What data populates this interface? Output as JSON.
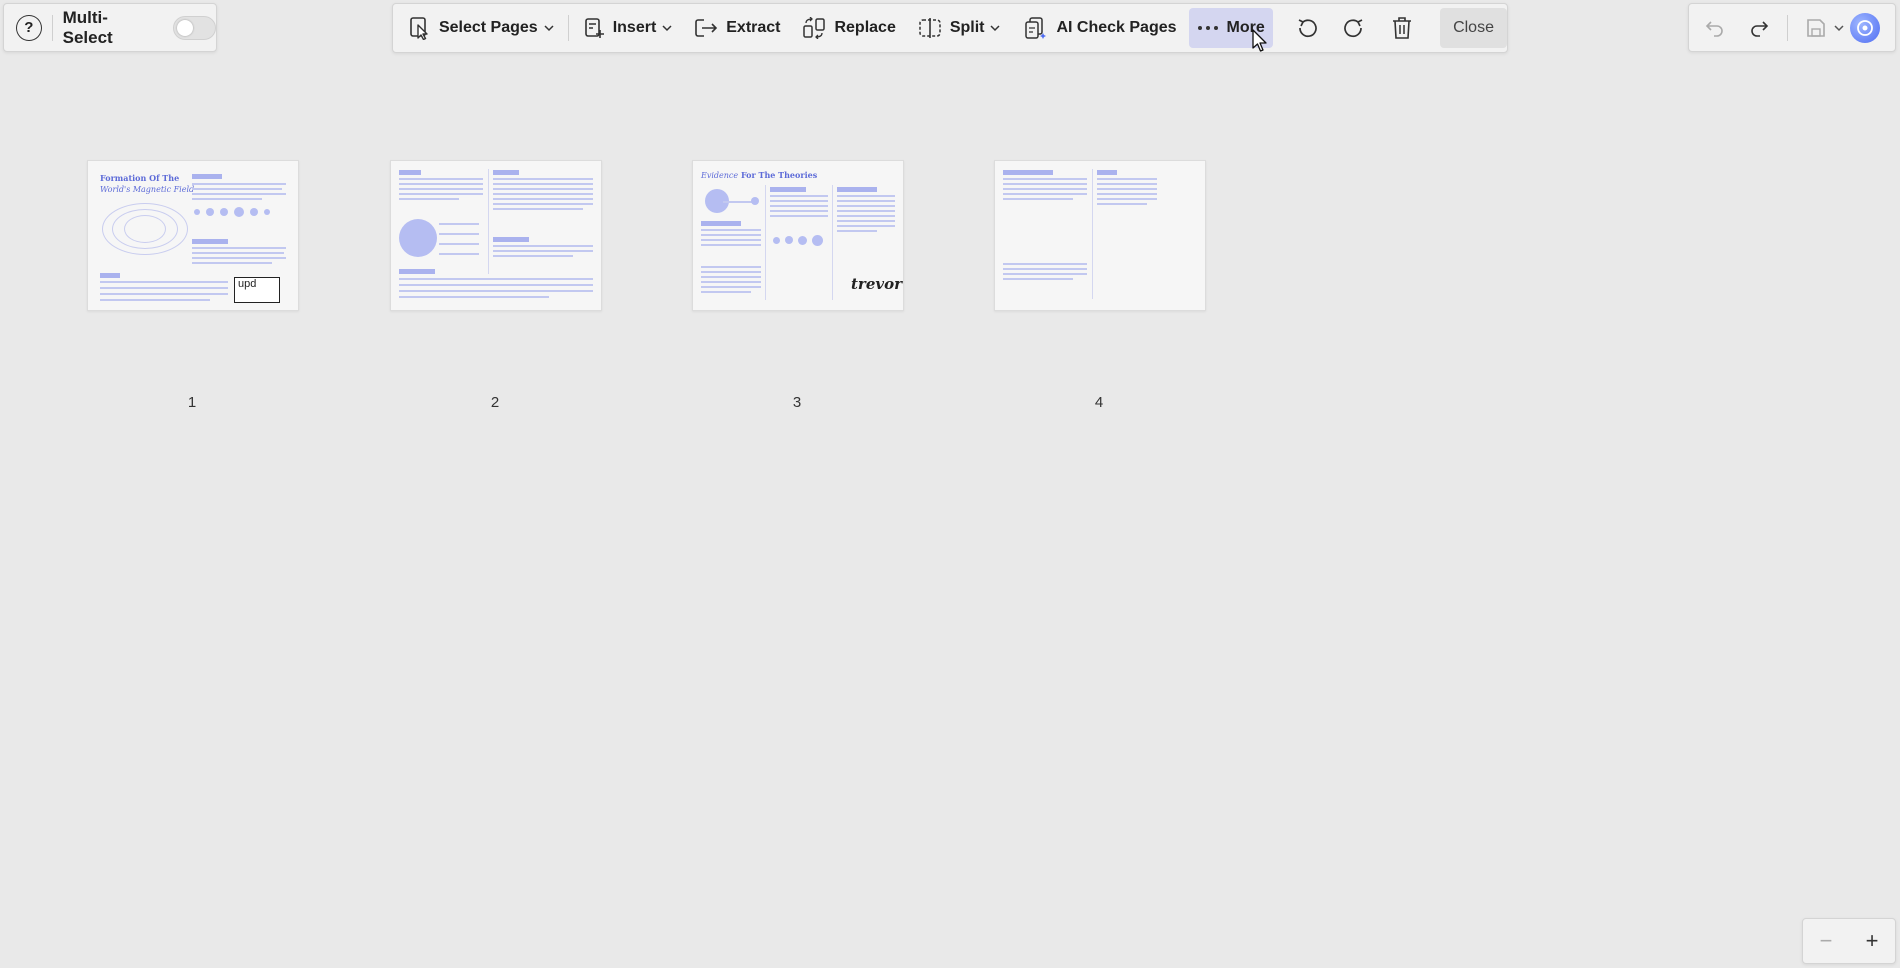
{
  "left_panel": {
    "help_symbol": "?",
    "multi_select_label": "Multi-Select",
    "multi_select_on": false
  },
  "toolbar": {
    "select_pages": "Select Pages",
    "insert": "Insert",
    "extract": "Extract",
    "replace": "Replace",
    "split": "Split",
    "ai_check": "AI Check Pages",
    "more": "More",
    "close": "Close"
  },
  "pages": [
    {
      "number": "1",
      "title_a": "Formation Of The",
      "title_b": "World's Magnetic Field",
      "stamp": "upd"
    },
    {
      "number": "2"
    },
    {
      "number": "3",
      "title_a": "Evidence",
      "title_b": "For The Theories",
      "signature": "trevor"
    },
    {
      "number": "4"
    }
  ],
  "zoom": {
    "minus": "−",
    "plus": "+"
  },
  "colors": {
    "accent": "#5d6bd8",
    "active_bg": "#d4d6f0",
    "page_bg": "#e9e9e9"
  },
  "icons": [
    "help-icon",
    "select-pages-icon",
    "insert-icon",
    "extract-icon",
    "replace-icon",
    "split-icon",
    "ai-check-icon",
    "more-icon",
    "undo-icon",
    "redo-icon",
    "trash-icon",
    "cursor-icon",
    "save-icon",
    "ai-assistant-icon"
  ]
}
